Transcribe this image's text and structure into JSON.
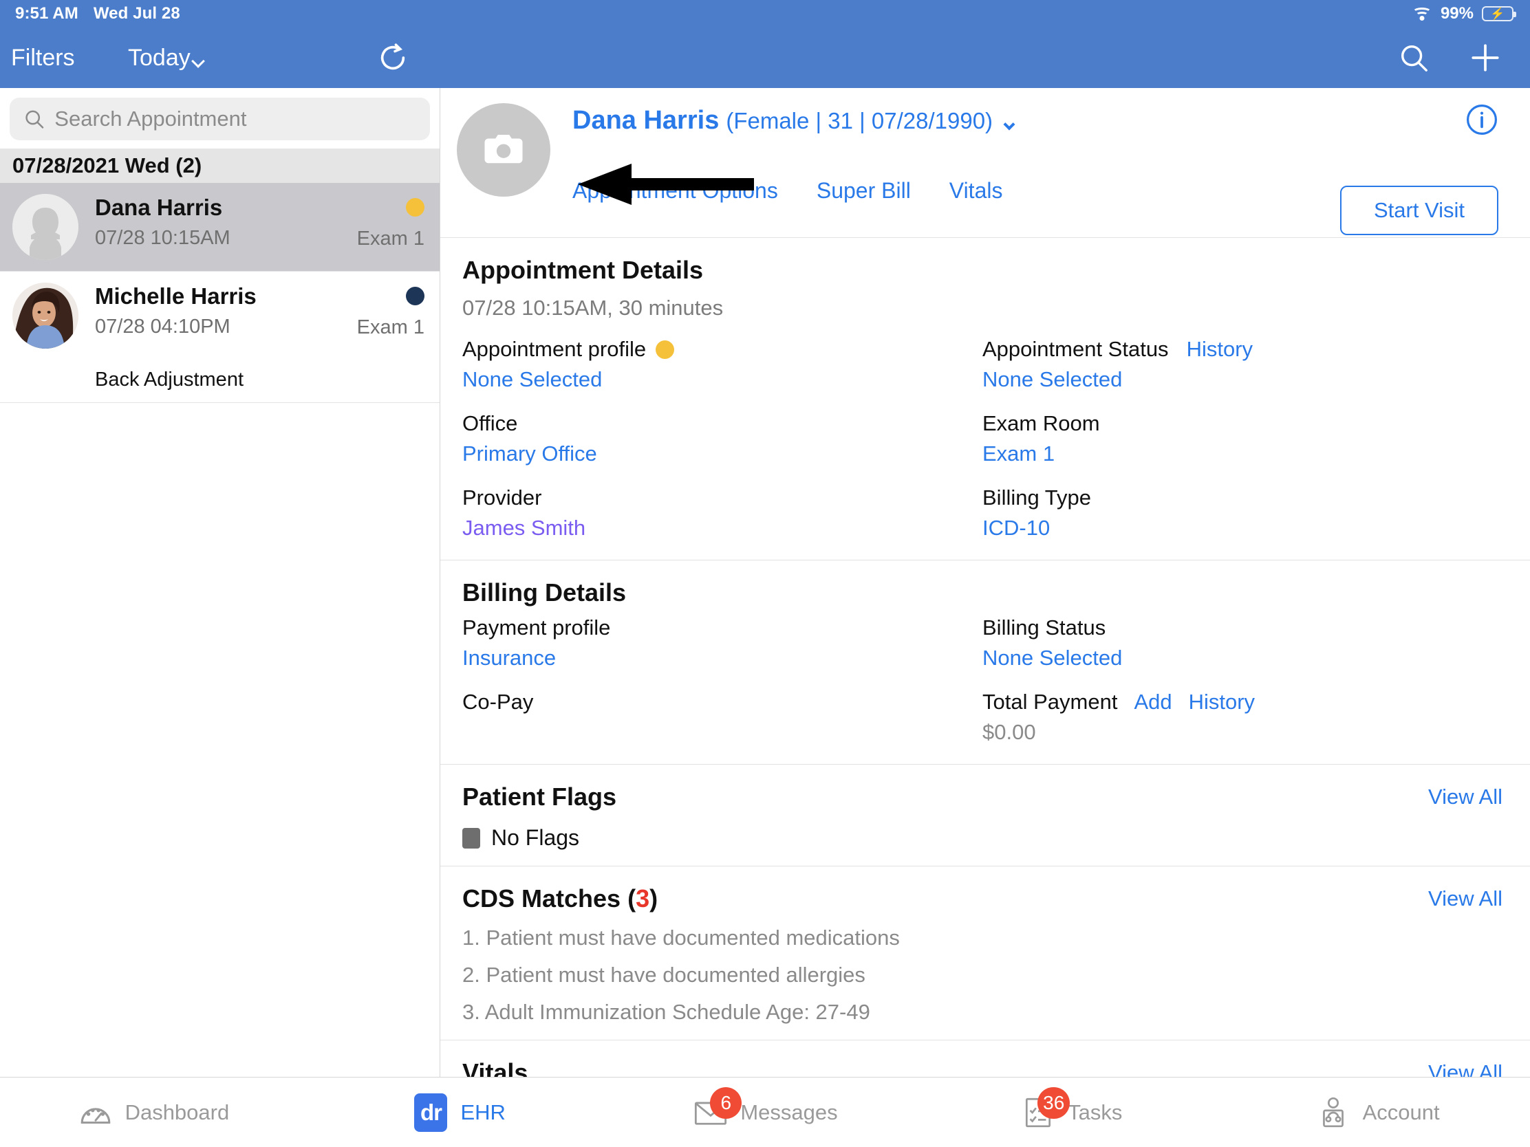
{
  "statusbar": {
    "time": "9:51 AM",
    "date": "Wed Jul 28",
    "battery_percent": "99%",
    "wifi_icon": "wifi-icon",
    "battery_icon": "battery-charging-icon"
  },
  "navbar": {
    "filters_label": "Filters",
    "today_label": "Today",
    "refresh_icon": "refresh-icon",
    "search_icon": "search-icon",
    "add_icon": "plus-icon"
  },
  "sidebar": {
    "search": {
      "value": "",
      "placeholder": "Search Appointment",
      "icon": "search-icon"
    },
    "day_header": "07/28/2021 Wed (2)",
    "appointments": [
      {
        "name": "Dana Harris",
        "time": "07/28 10:15AM",
        "room": "Exam 1",
        "reason": "",
        "status_color": "#f5c13b",
        "avatar": "placeholder-avatar",
        "selected": true
      },
      {
        "name": "Michelle Harris",
        "time": "07/28 04:10PM",
        "room": "Exam 1",
        "reason": "Back Adjustment",
        "status_color": "#1d3557",
        "avatar": "photo-avatar",
        "selected": false
      }
    ]
  },
  "patient_header": {
    "avatar_icon": "camera-icon",
    "name": "Dana Harris",
    "meta": "(Female | 31 | 07/28/1990)",
    "chevron_icon": "chevron-down-icon",
    "info_icon": "info-icon",
    "start_visit_label": "Start Visit",
    "links": [
      {
        "label": "Appointment Options"
      },
      {
        "label": "Super Bill"
      },
      {
        "label": "Vitals"
      }
    ]
  },
  "appointment_details": {
    "title": "Appointment Details",
    "subtitle": "07/28 10:15AM, 30 minutes",
    "fields": [
      {
        "label": "Appointment profile",
        "value": "None Selected",
        "dot": "#f5c13b"
      },
      {
        "label": "Appointment Status",
        "value": "None Selected",
        "action": "History"
      },
      {
        "label": "Office",
        "value": "Primary Office"
      },
      {
        "label": "Exam Room",
        "value": "Exam 1"
      },
      {
        "label": "Provider",
        "value": "James Smith"
      },
      {
        "label": "Billing Type",
        "value": "ICD-10"
      }
    ]
  },
  "billing_details": {
    "title": "Billing Details",
    "fields": [
      {
        "label": "Payment profile",
        "value": "Insurance"
      },
      {
        "label": "Billing Status",
        "value": "None Selected"
      },
      {
        "label": "Co-Pay",
        "value": ""
      },
      {
        "label": "Total Payment",
        "value": "$0.00",
        "action1": "Add",
        "action2": "History"
      }
    ]
  },
  "patient_flags": {
    "title": "Patient Flags",
    "view_all": "View All",
    "flag_text": "No Flags"
  },
  "cds_matches": {
    "title_prefix": "CDS Matches (",
    "count": "3",
    "title_suffix": ")",
    "view_all": "View All",
    "items": [
      "1. Patient must have documented medications",
      "2. Patient must have documented allergies",
      "3. Adult Immunization Schedule Age: 27-49"
    ]
  },
  "vitals": {
    "title": "Vitals",
    "view_all": "View All"
  },
  "tabbar": [
    {
      "label": "Dashboard",
      "icon": "gauge-icon",
      "badge": "",
      "active": false
    },
    {
      "label": "EHR",
      "icon": "dr-logo-icon",
      "badge": "",
      "active": true
    },
    {
      "label": "Messages",
      "icon": "envelope-icon",
      "badge": "6",
      "active": false
    },
    {
      "label": "Tasks",
      "icon": "checklist-icon",
      "badge": "36",
      "active": false
    },
    {
      "label": "Account",
      "icon": "person-headset-icon",
      "badge": "",
      "active": false
    }
  ],
  "colors": {
    "header_blue": "#4b7dca",
    "link_blue": "#2979e8",
    "purple": "#7b5cf0",
    "badge_red": "#ef4b35",
    "amber": "#f5c13b",
    "navy": "#1d3557"
  }
}
